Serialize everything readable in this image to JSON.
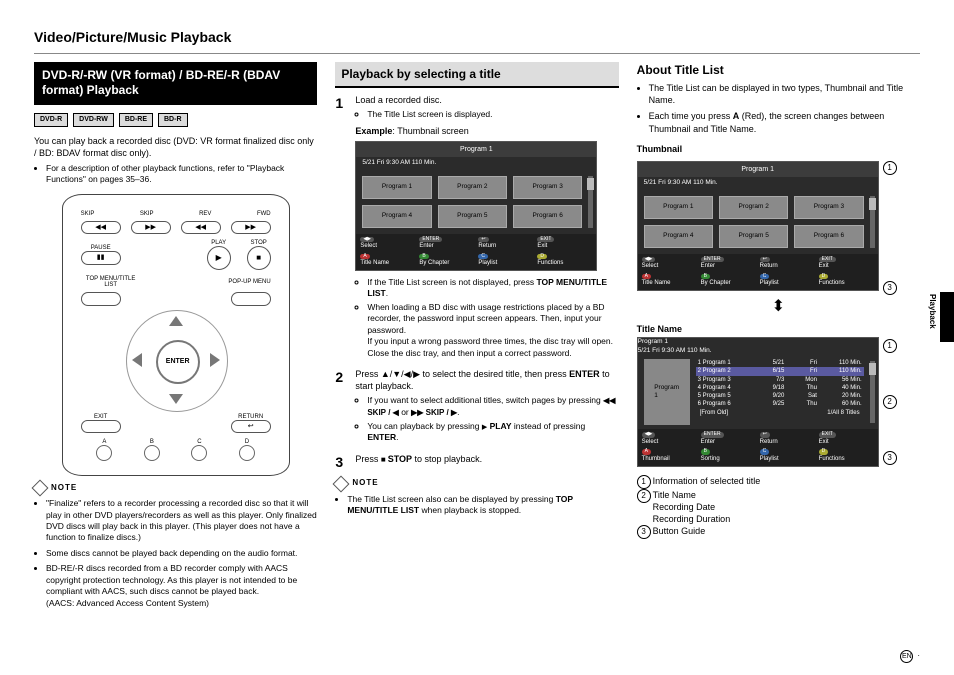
{
  "pageTitle": "Video/Picture/Music Playback",
  "blackHeader": "DVD-R/-RW (VR format) / BD-RE/-R (BDAV format) Playback",
  "discBadges": [
    "DVD-R",
    "DVD-RW",
    "BD-RE",
    "BD-R"
  ],
  "intro1": "You can play back a recorded disc (DVD: VR format finalized disc only / BD: BDAV format disc only).",
  "intro2": "For a description of other playback functions, refer to \"Playback Functions\" on pages 35–36.",
  "remote": {
    "skip": "SKIP",
    "rev": "REV",
    "fwd": "FWD",
    "pause": "PAUSE",
    "play": "PLAY",
    "stop": "STOP",
    "topmenu": "TOP MENU/TITLE LIST",
    "popup": "POP-UP MENU",
    "enter": "ENTER",
    "exit": "EXIT",
    "return": "RETURN",
    "a": "A",
    "b": "B",
    "c": "C",
    "d": "D"
  },
  "noteLabel": "NOTE",
  "col1notes": [
    "\"Finalize\" refers to a recorder processing a recorded disc so that it will play in other DVD players/recorders as well as this player. Only finalized DVD discs will play back in this player. (This player does not have a function to finalize discs.)",
    "Some discs cannot be played back depending on the audio format.",
    "BD-RE/-R discs recorded from a BD recorder comply with AACS copyright protection technology. As this player is not intended to be compliant with AACS, such discs cannot be played back.\n(AACS: Advanced Access Content System)"
  ],
  "greyHeader": "Playback by selecting a title",
  "step1": {
    "main": "Load a recorded disc.",
    "b1": "The Title List screen is displayed.",
    "example": "Example: Thumbnail screen",
    "afterBullets": [
      "If the Title List screen is not displayed, press TOP MENU/TITLE LIST.",
      "When loading a BD disc with usage restrictions placed by a BD recorder, the password input screen appears. Then, input your password.\nIf you input a wrong password three times, the disc tray will open. Close the disc tray, and then input a correct password."
    ]
  },
  "step2": {
    "main1": "Press ",
    "main2": " to select the desired title, then press ",
    "enter": "ENTER",
    "main3": " to start playback.",
    "bullets": [
      "If you want to select additional titles, switch pages by pressing  ◀◀ SKIP / ◀  or  ▶▶ SKIP / ▶ .",
      "You can playback by pressing ▶ PLAY instead of pressing ENTER."
    ]
  },
  "step3": {
    "pre": "Press ",
    "stop": "STOP",
    "post": " to stop playback."
  },
  "col2noteBullet": "The Title List screen also can be displayed by pressing TOP MENU/TITLE LIST when playback is stopped.",
  "thumb": {
    "title": "Program 1",
    "info": "5/21    Fri    9:30 AM    110 Min.",
    "cells": [
      "Program 1",
      "Program 2",
      "Program 3",
      "Program 4",
      "Program 5",
      "Program 6"
    ],
    "footer": [
      {
        "k": "◀▶",
        "l1": "Select",
        "k2": "A",
        "l2": "Title Name"
      },
      {
        "k": "ENTER",
        "l1": "Enter",
        "k2": "B",
        "l2": "By Chapter"
      },
      {
        "k": "↩",
        "l1": "Return",
        "k2": "C",
        "l2": "Playlist"
      },
      {
        "k": "EXIT",
        "l1": "Exit",
        "k2": "D",
        "l2": "Functions"
      }
    ]
  },
  "aboutTitle": "About Title List",
  "aboutBullets": [
    "The Title List can be displayed in two types, Thumbnail and Title Name.",
    "Each time you press A (Red), the screen changes between Thumbnail and Title Name."
  ],
  "thumbnailLabel": "Thumbnail",
  "titleNameLabel": "Title Name",
  "titleListRows": [
    {
      "n": "1 Program 1",
      "d": "5/21",
      "w": "Fri",
      "m": "110 Min."
    },
    {
      "n": "2 Program 2",
      "d": "6/15",
      "w": "Fri",
      "m": "110 Min."
    },
    {
      "n": "3 Program 3",
      "d": "7/3",
      "w": "Mon",
      "m": "56 Min."
    },
    {
      "n": "4 Program 4",
      "d": "9/18",
      "w": "Thu",
      "m": "40 Min."
    },
    {
      "n": "5 Program 5",
      "d": "9/20",
      "w": "Sat",
      "m": "20 Min."
    },
    {
      "n": "6 Program 6",
      "d": "9/25",
      "w": "Thu",
      "m": "60 Min."
    }
  ],
  "titleListBottom": {
    "left": "[From Old]",
    "right": "1/All 8 Titles"
  },
  "tlFooter": [
    {
      "k": "◀▶",
      "l1": "Select",
      "k2": "A",
      "l2": "Thumbnail"
    },
    {
      "k": "ENTER",
      "l1": "Enter",
      "k2": "B",
      "l2": "Sorting"
    },
    {
      "k": "↩",
      "l1": "Return",
      "k2": "C",
      "l2": "Playlist"
    },
    {
      "k": "EXIT",
      "l1": "Exit",
      "k2": "D",
      "l2": "Functions"
    }
  ],
  "legend": [
    "Information of selected title",
    "Title Name\nRecording Date\nRecording Duration",
    "Button Guide"
  ],
  "sideLabel": "Playback",
  "pageLang": "EN"
}
